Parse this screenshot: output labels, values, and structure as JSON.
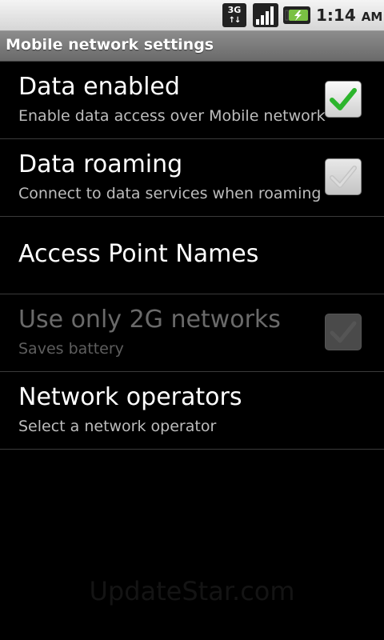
{
  "status_bar": {
    "network_type": "3G",
    "time": "1:14",
    "ampm": "AM",
    "icons": [
      "3g-data-icon",
      "signal-strength-icon",
      "battery-charging-icon"
    ]
  },
  "title_bar": {
    "title": "Mobile network settings"
  },
  "preferences": [
    {
      "title": "Data enabled",
      "summary": "Enable data access over Mobile network",
      "checked": true,
      "enabled": true
    },
    {
      "title": "Data roaming",
      "summary": "Connect to data services when roaming",
      "checked": true,
      "enabled": true
    },
    {
      "title": "Access Point Names"
    },
    {
      "title": "Use only 2G networks",
      "summary": "Saves battery",
      "checked": false,
      "enabled": false
    },
    {
      "title": "Network operators",
      "summary": "Select a network operator"
    }
  ],
  "watermark": "UpdateStar.com",
  "colors": {
    "check_green": "#2db52d",
    "background": "#000000",
    "title_bar": "#7a7a7a"
  }
}
